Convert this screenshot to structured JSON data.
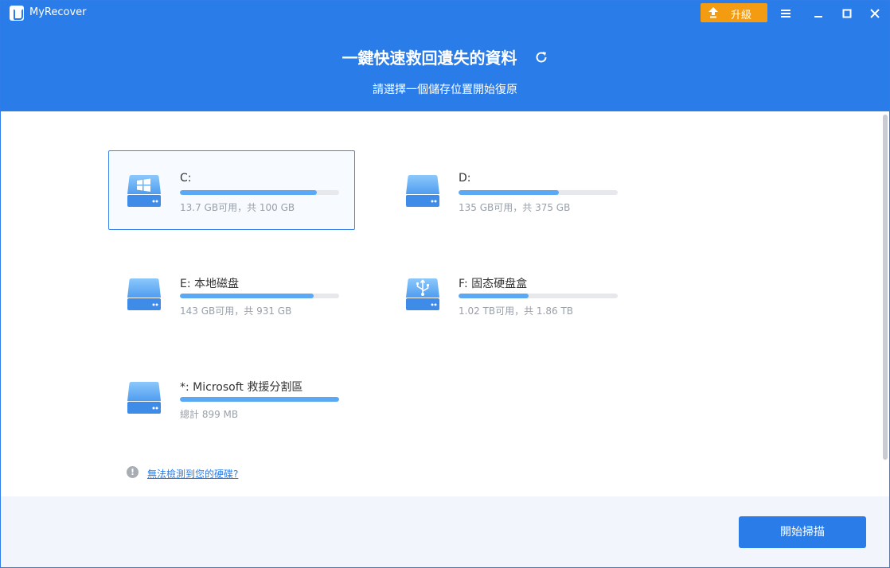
{
  "app": {
    "name": "MyRecover",
    "upgrade_label": "升級"
  },
  "header": {
    "title": "一鍵快速救回遺失的資料",
    "subtitle": "請選擇一個儲存位置開始復原"
  },
  "drives": [
    {
      "name": "C:",
      "info": "13.7 GB可用，共 100 GB",
      "used_fraction": 0.86,
      "icon": "windows-drive-icon",
      "selected": true
    },
    {
      "name": "D:",
      "info": "135 GB可用，共 375 GB",
      "used_fraction": 0.63,
      "icon": "drive-icon",
      "selected": false
    },
    {
      "name": "E: 本地磁盘",
      "info": "143 GB可用，共 931 GB",
      "used_fraction": 0.84,
      "icon": "drive-icon",
      "selected": false
    },
    {
      "name": "F: 固态硬盘盒",
      "info": "1.02 TB可用，共 1.86 TB",
      "used_fraction": 0.44,
      "icon": "usb-drive-icon",
      "selected": false
    },
    {
      "name": "*: Microsoft 救援分割區",
      "info": "總計 899 MB",
      "used_fraction": 1.0,
      "icon": "drive-icon",
      "selected": false
    }
  ],
  "help_link": "無法檢測到您的硬碟?",
  "start_button": "開始掃描",
  "colors": {
    "accent": "#2a7de9",
    "upgrade": "#f39c12",
    "bar_fill": "#5ba8f5"
  }
}
